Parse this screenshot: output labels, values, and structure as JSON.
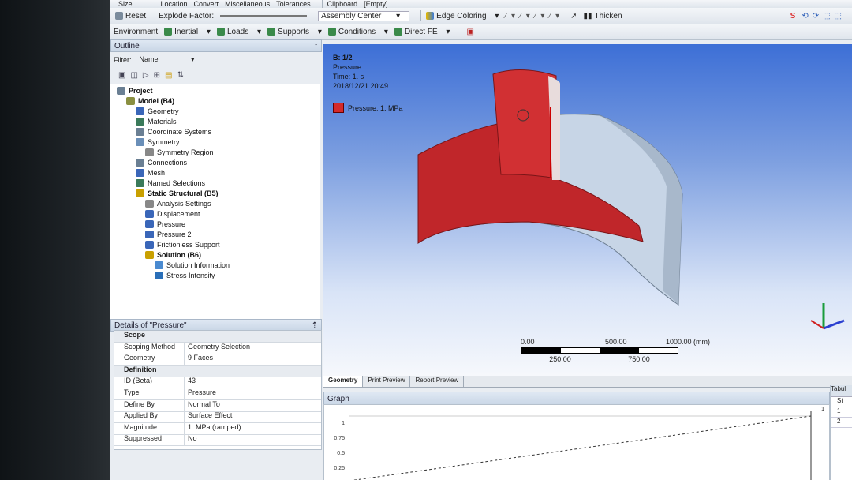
{
  "toolbar1": {
    "size": "Size",
    "location": "Location",
    "convert": "Convert",
    "misc": "Miscellaneous",
    "tolerances": "Tolerances",
    "clipboard": "Clipboard",
    "clipboard_value": "[Empty]"
  },
  "toolbar2": {
    "reset": "Reset",
    "explode": "Explode Factor:",
    "assembly": "Assembly Center",
    "edge_coloring": "Edge Coloring",
    "thicken": "Thicken"
  },
  "toolbar3": {
    "environment": "Environment",
    "inertial": "Inertial",
    "loads": "Loads",
    "supports": "Supports",
    "conditions": "Conditions",
    "direct_fe": "Direct FE"
  },
  "outline": {
    "title": "Outline",
    "pin": "↑",
    "filter_label": "Filter:",
    "filter_value": "Name",
    "nodes": [
      {
        "label": "Project",
        "bold": true
      },
      {
        "label": "Model (B4)",
        "bold": true
      },
      {
        "label": "Geometry"
      },
      {
        "label": "Materials"
      },
      {
        "label": "Coordinate Systems"
      },
      {
        "label": "Symmetry"
      },
      {
        "label": "Symmetry Region"
      },
      {
        "label": "Connections"
      },
      {
        "label": "Mesh"
      },
      {
        "label": "Named Selections"
      },
      {
        "label": "Static Structural (B5)",
        "bold": true
      },
      {
        "label": "Analysis Settings"
      },
      {
        "label": "Displacement"
      },
      {
        "label": "Pressure"
      },
      {
        "label": "Pressure 2"
      },
      {
        "label": "Frictionless Support"
      },
      {
        "label": "Solution (B6)",
        "bold": true
      },
      {
        "label": "Solution Information"
      },
      {
        "label": "Stress Intensity"
      }
    ]
  },
  "details": {
    "title": "Details of \"Pressure\"",
    "rows": [
      {
        "section": "Scope"
      },
      {
        "k": "Scoping Method",
        "v": "Geometry Selection"
      },
      {
        "k": "Geometry",
        "v": "9 Faces"
      },
      {
        "section": "Definition"
      },
      {
        "k": "ID (Beta)",
        "v": "43"
      },
      {
        "k": "Type",
        "v": "Pressure"
      },
      {
        "k": "Define By",
        "v": "Normal To"
      },
      {
        "k": "Applied By",
        "v": "Surface Effect"
      },
      {
        "k": "Magnitude",
        "v": "1. MPa  (ramped)"
      },
      {
        "k": "Suppressed",
        "v": "No"
      }
    ]
  },
  "viewport": {
    "label1": "B: 1/2",
    "label2": "Pressure",
    "label3": "Time: 1. s",
    "label4": "2018/12/21 20:49",
    "legend": "Pressure: 1. MPa",
    "legend_color": "#d42a2a",
    "scale_top": [
      "0.00",
      "500.00",
      "1000.00 (mm)"
    ],
    "scale_bottom": [
      "250.00",
      "750.00"
    ]
  },
  "tabs": [
    "Geometry",
    "Print Preview",
    "Report Preview"
  ],
  "graph": {
    "title": "Graph",
    "yticks": [
      "1",
      "0.75",
      "0.5",
      "0.25"
    ],
    "end_label": "1"
  },
  "tabular": {
    "title": "Tabul",
    "rows": [
      "St",
      "1",
      "2"
    ]
  }
}
